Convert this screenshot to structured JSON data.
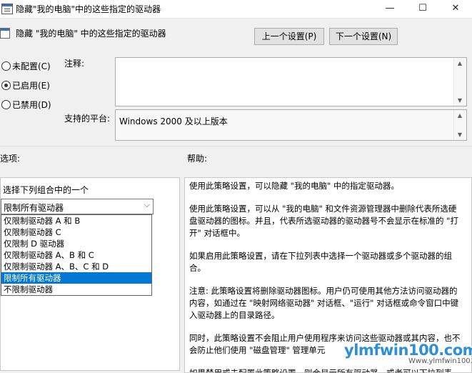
{
  "window": {
    "title": "隐藏\"我的电脑\"中的这些指定的驱动器",
    "min_glyph": "—",
    "max_glyph": "☐",
    "close_glyph": "✕"
  },
  "header": {
    "policy_name": "隐藏 \"我的电脑\" 中的这些指定的驱动器",
    "prev_button": "上一个设置(P)",
    "next_button": "下一个设置(N)"
  },
  "state": {
    "not_configured": "未配置(C)",
    "enabled": "已启用(E)",
    "disabled": "已禁用(D)",
    "selected": "enabled"
  },
  "comment": {
    "label": "注释:",
    "value": ""
  },
  "platform": {
    "label": "支持的平台:",
    "value": "Windows 2000 及以上版本"
  },
  "options": {
    "label": "选项:",
    "select_caption": "选择下列组合中的一个",
    "selected_value": "限制所有驱动器",
    "list": [
      "仅限制驱动器 A 和 B",
      "仅限制驱动器 C",
      "仅限制 D 驱动器",
      "仅限制驱动器 A、B 和 C",
      "仅限制驱动器 A、B、C 和 D",
      "限制所有驱动器",
      "不限制驱动器"
    ],
    "highlighted_index": 5
  },
  "help": {
    "label": "帮助:",
    "paragraphs": [
      "使用此策略设置，可以隐藏 \"我的电脑\" 中的指定驱动器。",
      "使用此策略设置，可以从 \"我的电脑\" 和文件资源管理器中删除代表所选硬盘驱动器的图标。并且，代表所选驱动器的驱动器号不会显示在标准的 \"打开\" 对话框中。",
      "如果启用此策略设置，请在下拉列表中选择一个驱动器或多个驱动器的组合。",
      "注意: 此策略设置将删除驱动器图标。用户仍可使用其他方法访问驱动器的内容，如通过在 \"映射网络驱动器\" 对话框、\"运行\" 对话框或命令窗口中键入驱动器上的目录路径。",
      "同时，此策略设置不会阻止用户使用程序来访问这些驱动器或其内容，也不会防止他们使用 \"磁盘管理\" 管理单元",
      "如果禁用或未配置此策略设置，则会显示所有驱动器，或者可以下拉列表"
    ]
  },
  "watermark": {
    "text": "ylmfwin100.com",
    "sub": "Www.ylmfwin100.com"
  },
  "colors": {
    "accent": "#0078d7",
    "watermark": "#2e8fd8"
  }
}
